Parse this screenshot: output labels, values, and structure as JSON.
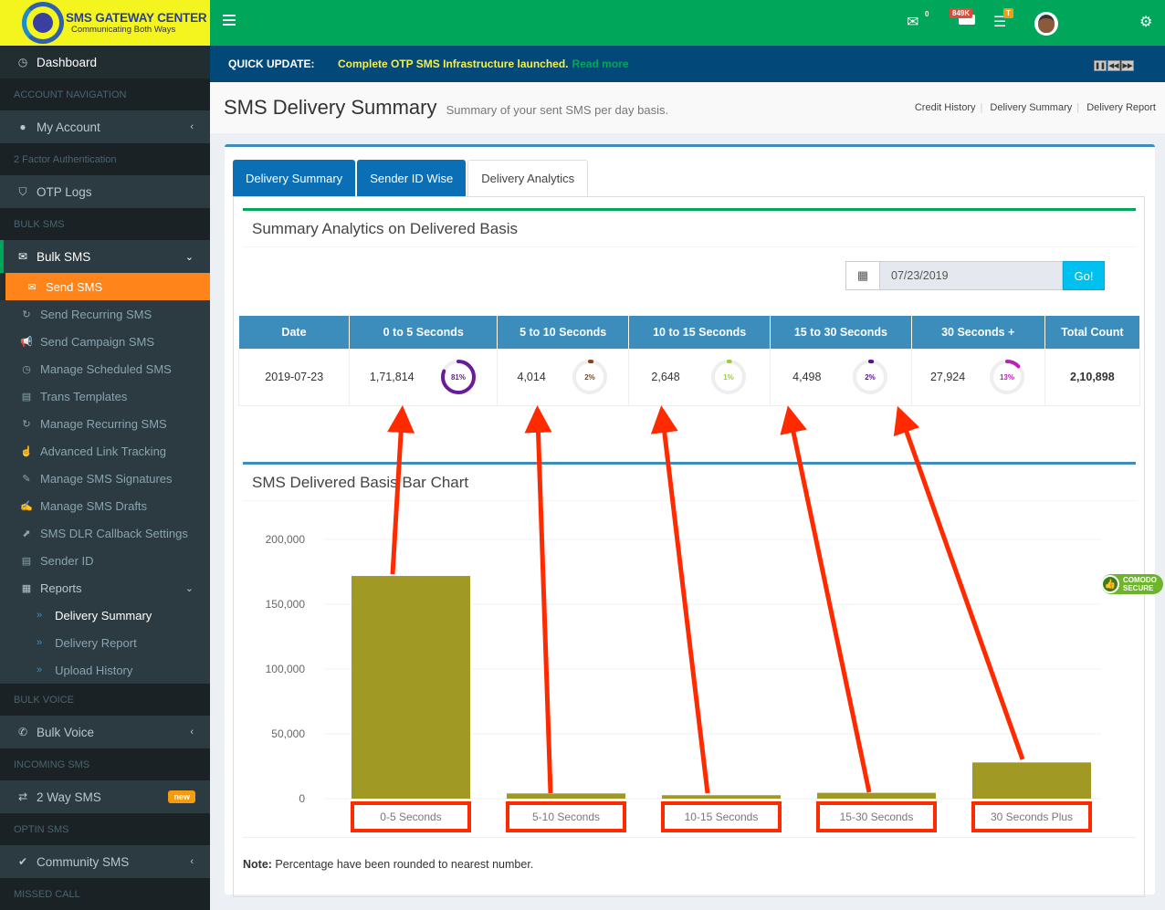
{
  "brand": {
    "name": "SMS GATEWAY CENTER",
    "tagline": "Communicating Both Ways"
  },
  "topbar": {
    "menu_icon": "hamburger-icon",
    "mail_count": "0",
    "credits_badge": "849K",
    "tasks_badge": "T",
    "settings_icon": "gears-icon"
  },
  "quick_update": {
    "label": "QUICK UPDATE:",
    "message": "Complete OTP SMS Infrastructure launched.",
    "link": "Read more"
  },
  "sidebar": {
    "dashboard": "Dashboard",
    "section_account": "ACCOUNT NAVIGATION",
    "my_account": "My Account",
    "section_2fa": "2 Factor Authentication",
    "otp_logs": "OTP Logs",
    "section_bulk": "BULK SMS",
    "bulk_sms": "Bulk SMS",
    "bulk_items": [
      {
        "label": "Send SMS",
        "icon": "envelope-icon"
      },
      {
        "label": "Send Recurring SMS",
        "icon": "refresh-icon"
      },
      {
        "label": "Send Campaign SMS",
        "icon": "bullhorn-icon"
      },
      {
        "label": "Manage Scheduled SMS",
        "icon": "clock-icon"
      },
      {
        "label": "Trans Templates",
        "icon": "inbox-icon"
      },
      {
        "label": "Manage Recurring SMS",
        "icon": "refresh-icon"
      },
      {
        "label": "Advanced Link Tracking",
        "icon": "hand-pointer-icon"
      },
      {
        "label": "Manage SMS Signatures",
        "icon": "pencil-icon"
      },
      {
        "label": "Manage SMS Drafts",
        "icon": "edit-icon"
      },
      {
        "label": "SMS DLR Callback Settings",
        "icon": "external-link-icon"
      },
      {
        "label": "Sender ID",
        "icon": "file-icon"
      }
    ],
    "reports": "Reports",
    "report_items": [
      "Delivery Summary",
      "Delivery Report",
      "Upload History"
    ],
    "section_voice": "BULK VOICE",
    "bulk_voice": "Bulk Voice",
    "section_incoming": "INCOMING SMS",
    "two_way": "2 Way SMS",
    "new_badge": "new",
    "section_optin": "OPTIN SMS",
    "community": "Community SMS",
    "section_missed": "MISSED CALL"
  },
  "header": {
    "title": "SMS Delivery Summary",
    "subtitle": "Summary of your sent SMS per day basis.",
    "links": [
      "Credit History",
      "Delivery Summary",
      "Delivery Report"
    ]
  },
  "tabs": [
    "Delivery Summary",
    "Sender ID Wise",
    "Delivery Analytics"
  ],
  "summary": {
    "title": "Summary Analytics on Delivered Basis",
    "date_value": "07/23/2019",
    "go_label": "Go!",
    "columns": [
      "Date",
      "0 to 5 Seconds",
      "5 to 10 Seconds",
      "10 to 15 Seconds",
      "15 to 30 Seconds",
      "30 Seconds +",
      "Total Count"
    ],
    "row": {
      "date": "2019-07-23",
      "cells": [
        {
          "count": "1,71,814",
          "pct": 81,
          "pct_label": "81%",
          "color": "#6a1b9a"
        },
        {
          "count": "4,014",
          "pct": 2,
          "pct_label": "2%",
          "color": "#8b4513"
        },
        {
          "count": "2,648",
          "pct": 1,
          "pct_label": "1%",
          "color": "#9acd32"
        },
        {
          "count": "4,498",
          "pct": 2,
          "pct_label": "2%",
          "color": "#5b0e91"
        },
        {
          "count": "27,924",
          "pct": 13,
          "pct_label": "13%",
          "color": "#b624b6"
        }
      ],
      "total": "2,10,898"
    }
  },
  "chart_data": {
    "type": "bar",
    "title": "SMS Delivered Basis Bar Chart",
    "categories": [
      "0-5 Seconds",
      "5-10 Seconds",
      "10-15 Seconds",
      "15-30 Seconds",
      "30 Seconds Plus"
    ],
    "values": [
      171814,
      4014,
      2648,
      4498,
      27924
    ],
    "ylim": [
      0,
      200000
    ],
    "yticks": [
      0,
      50000,
      100000,
      150000,
      200000
    ],
    "ytick_labels": [
      "0",
      "50,000",
      "100,000",
      "150,000",
      "200,000"
    ],
    "bar_color": "#a09a24",
    "annotation_color": "#ff2a00",
    "xlabel": "",
    "ylabel": "",
    "grid": true
  },
  "note": {
    "label": "Note:",
    "text": " Percentage have been rounded to nearest number."
  },
  "comodo": {
    "line1": "COMODO",
    "line2": "SECURE"
  }
}
